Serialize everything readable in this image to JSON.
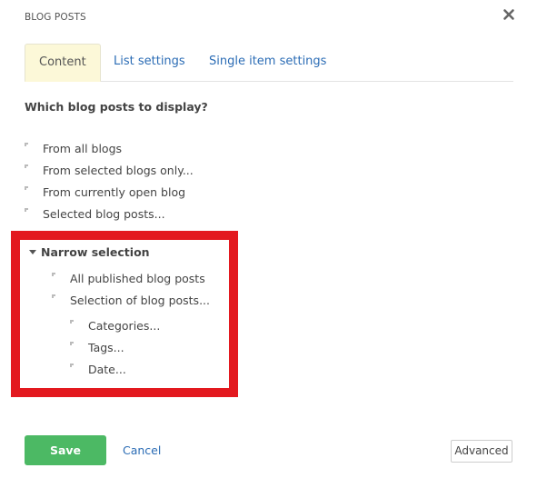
{
  "dialog": {
    "title": "BLOG POSTS",
    "close_icon": "close-icon"
  },
  "tabs": [
    {
      "label": "Content",
      "active": true
    },
    {
      "label": "List settings",
      "active": false
    },
    {
      "label": "Single item settings",
      "active": false
    }
  ],
  "content": {
    "question": "Which blog posts to display?",
    "options": [
      {
        "label": "From all blogs"
      },
      {
        "label": "From selected blogs only..."
      },
      {
        "label": "From currently open blog"
      },
      {
        "label": "Selected blog posts..."
      }
    ],
    "narrow_selection": {
      "header": "Narrow selection",
      "expanded": true,
      "options": [
        {
          "label": "All published blog posts"
        },
        {
          "label": "Selection of blog posts..."
        }
      ],
      "sub_options": [
        {
          "label": "Categories..."
        },
        {
          "label": "Tags..."
        },
        {
          "label": "Date..."
        }
      ]
    }
  },
  "footer": {
    "save_label": "Save",
    "cancel_label": "Cancel",
    "advanced_label": "Advanced"
  },
  "colors": {
    "accent_link": "#2b6cb5",
    "save_green": "#4cb964",
    "highlight_red": "#e3191f",
    "active_tab_bg": "#fcf8d8"
  }
}
